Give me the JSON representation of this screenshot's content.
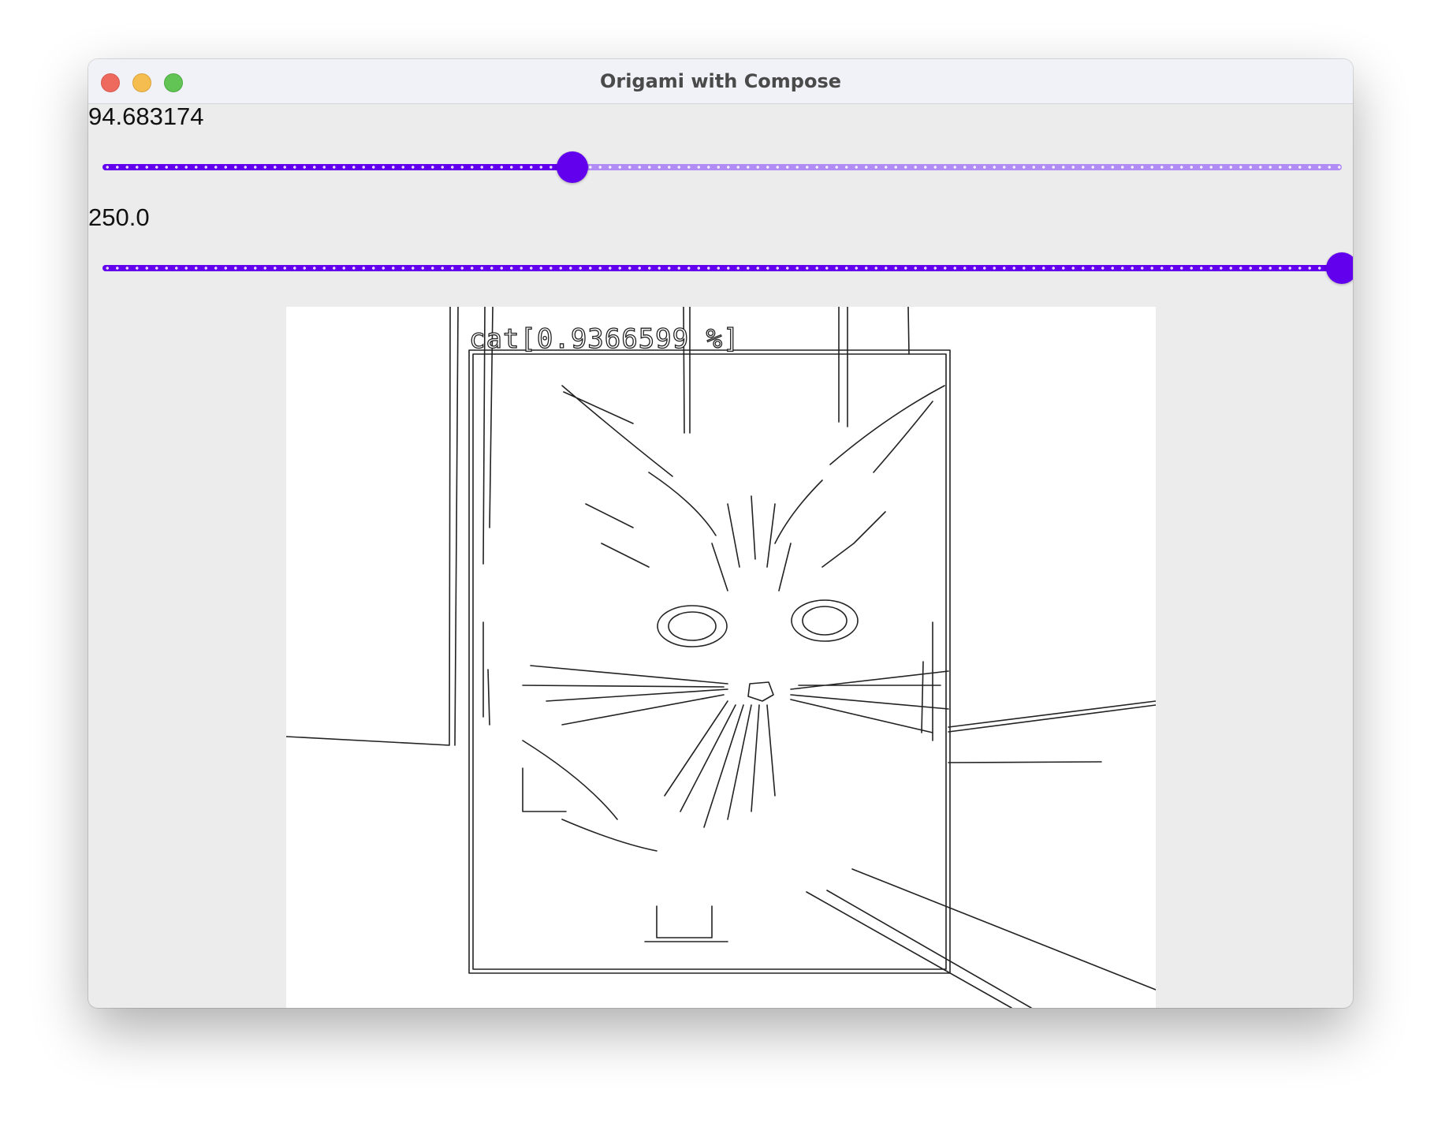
{
  "window": {
    "title": "Origami with Compose"
  },
  "controls": {
    "slider1": {
      "value_text": "94.683174",
      "fraction": 0.379
    },
    "slider2": {
      "value_text": "250.0",
      "fraction": 1.0
    },
    "accent_color": "#6200ee",
    "inactive_track_color": "#b18cf5"
  },
  "image": {
    "detection_label": "cat[0.9366599 %]",
    "content": "edge-detected cat photo with bounding box"
  }
}
